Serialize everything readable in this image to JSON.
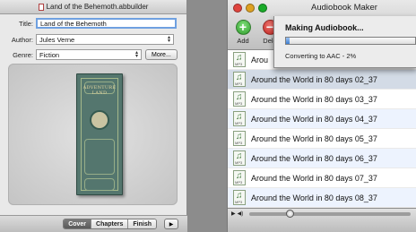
{
  "left_window": {
    "title": "Land of the Behemoth.abbuilder",
    "fields": {
      "title_label": "Title:",
      "title_value": "Land of the Behemoth",
      "author_label": "Author:",
      "author_value": "Jules Verne",
      "genre_label": "Genre:",
      "genre_value": "Fiction",
      "more_button": "More..."
    },
    "cover_art_text": "ADVENTURE LAND",
    "tabs": [
      "Cover",
      "Chapters",
      "Finish"
    ],
    "selected_tab": "Cover"
  },
  "right_window": {
    "title": "Audiobook Maker",
    "toolbar": {
      "add_label": "Add",
      "delete_label": "Dele"
    },
    "progress_sheet": {
      "title": "Making Audiobook...",
      "status": "Converting to AAC - 2%",
      "progress": 0.02
    },
    "tracks": [
      "Arou",
      "Around the World in 80 days 02_37",
      "Around the World in 80 days 03_37",
      "Around the World in 80 days 04_37",
      "Around the World in 80 days 05_37",
      "Around the World in 80 days 06_37",
      "Around the World in 80 days 07_37",
      "Around the World in 80 days 08_37"
    ],
    "playback_position": 0.25
  },
  "colors": {
    "add_green": "#3fb43a",
    "delete_red": "#d8322c",
    "selection_blue": "#3d7ed1",
    "close_light": "#e0443e",
    "minimize_light": "#dea123",
    "zoom_light": "#1aab29"
  }
}
